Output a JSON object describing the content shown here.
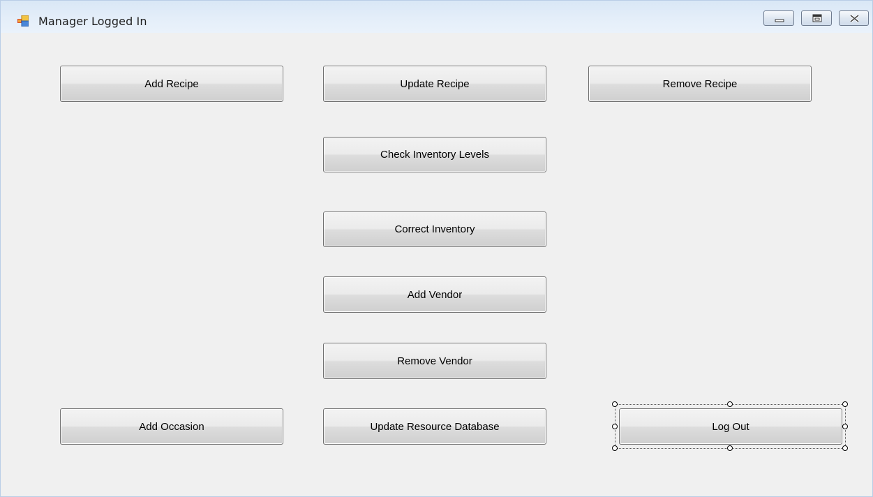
{
  "window": {
    "title": "Manager Logged In",
    "app_icon": "winforms-app-icon",
    "controls": [
      "minimize-icon",
      "maximize-icon",
      "close-icon"
    ]
  },
  "buttons": {
    "add_recipe": "Add Recipe",
    "update_recipe": "Update Recipe",
    "remove_recipe": "Remove Recipe",
    "check_inventory_levels": "Check Inventory Levels",
    "correct_inventory": "Correct Inventory",
    "add_vendor": "Add Vendor",
    "remove_vendor": "Remove Vendor",
    "add_occasion": "Add Occasion",
    "update_resource_database": "Update Resource Database",
    "log_out": "Log Out"
  },
  "colors": {
    "titlebar": "#dfeaf7",
    "client_background": "#f0f0f0",
    "button_border": "#707070"
  }
}
